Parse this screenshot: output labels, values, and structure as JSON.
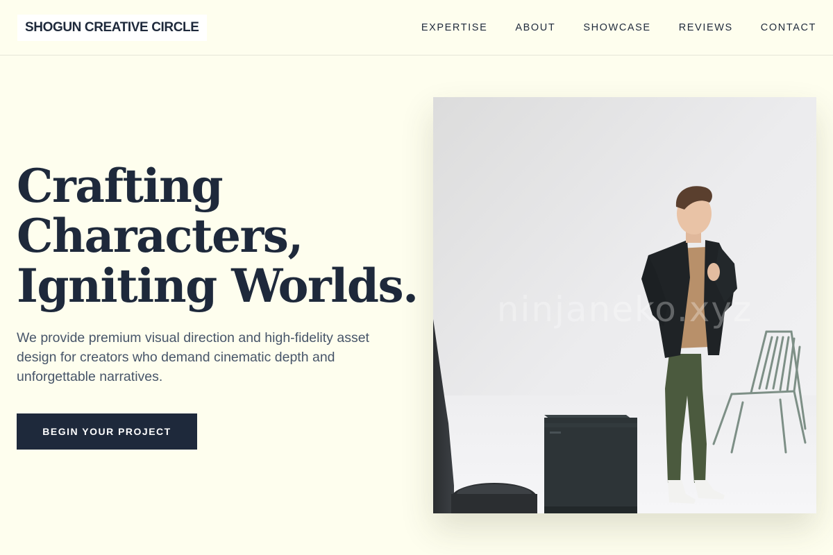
{
  "header": {
    "logo": "SHOGUN CREATIVE CIRCLE",
    "nav": [
      "EXPERTISE",
      "ABOUT",
      "SHOWCASE",
      "REVIEWS",
      "CONTACT"
    ]
  },
  "hero": {
    "title_lines": [
      "Crafting",
      "Characters,",
      "Igniting Worlds."
    ],
    "subtitle": "We provide premium visual direction and high-fidelity asset design for creators who demand cinematic depth and unforgettable narratives.",
    "cta_label": "BEGIN YOUR PROJECT",
    "image": {
      "description": "model-in-studio-photo",
      "watermark": "ninjaneko.xyz"
    }
  },
  "colors": {
    "background": "#fefeee",
    "ink": "#1e293b",
    "muted_text": "#475569",
    "cta_background": "#1e293b",
    "cta_text": "#ffffff"
  }
}
